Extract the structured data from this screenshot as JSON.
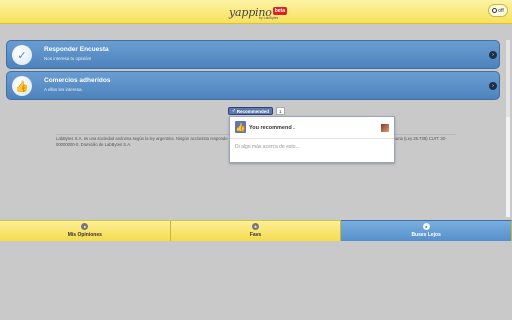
{
  "header": {
    "logo_text": "yappino",
    "logo_badge": "beta",
    "logo_sub": "by LabBytes",
    "off_label": "off"
  },
  "menu": [
    {
      "title": "Responder Encuesta",
      "subtitle": "Nos interesa tu opinión!",
      "icon": "checkmark-icon"
    },
    {
      "title": "Comercios adheridos",
      "subtitle": "A ellos les interesa.",
      "icon": "thumbs-up-icon"
    }
  ],
  "legal_text": "LabBytes S.A. es una sociedad anónima según la ley argentina. Ningún accionista responde por las operaciones de la sociedad ni a ningún Banco, en exceso de su integración accionaria (Ley 25.738) CUIT: 30-00000000-0. Domicilio de LabBytes S.A.",
  "facebook": {
    "recommend_label": "Recommended",
    "count": "1",
    "popup_title": "You recommend .",
    "comment_placeholder": "Di algo más acerca de esto..."
  },
  "tabs": [
    {
      "label": "Mis Opiniones",
      "icon": "chat-icon",
      "active": false
    },
    {
      "label": "Favs",
      "icon": "star-icon",
      "active": false
    },
    {
      "label": "Buses Lejos",
      "icon": "location-icon",
      "active": true
    }
  ],
  "colors": {
    "header_yellow": "#f7e15a",
    "menu_blue": "#5690cb",
    "background_gray": "#c9c9c9",
    "facebook_blue": "#5f78ab"
  }
}
